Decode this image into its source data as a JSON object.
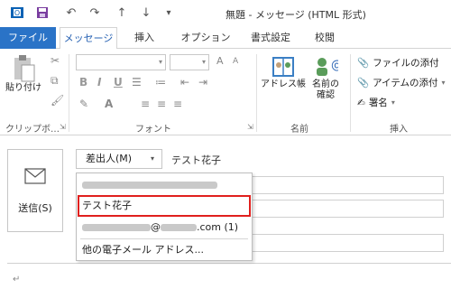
{
  "title": "無題 - メッセージ (HTML 形式)",
  "quick_access": {
    "save_icon": "save-icon",
    "undo_icon": "undo-icon",
    "redo_icon": "redo-icon",
    "up_icon": "arrow-up-icon",
    "down_icon": "arrow-down-icon",
    "customize_icon": "customize-icon"
  },
  "tabs": {
    "file": "ファイル",
    "message": "メッセージ",
    "insert": "挿入",
    "options": "オプション",
    "format": "書式設定",
    "review": "校閲"
  },
  "ribbon": {
    "clipboard": {
      "paste": "貼り付け",
      "label": "クリップボ…"
    },
    "font": {
      "label": "フォント"
    },
    "names": {
      "address_book": "アドレス帳",
      "check_names_line1": "名前の",
      "check_names_line2": "確認",
      "label": "名前"
    },
    "include": {
      "attach_file": "ファイルの添付",
      "attach_item": "アイテムの添付",
      "signature": "署名",
      "label": "挿入"
    }
  },
  "compose": {
    "send": "送信(S)",
    "from_button": "差出人(M)",
    "from_name": "テスト花子"
  },
  "dropdown": {
    "item_selected": "テスト花子",
    "item_second_domain": "@",
    "item_second_suffix": ".com (1)",
    "item_other": "他の電子メール アドレス..."
  },
  "colors": {
    "file_tab": "#2a73c7",
    "active_tab_text": "#2a64b4",
    "highlight": "#e0201e"
  }
}
